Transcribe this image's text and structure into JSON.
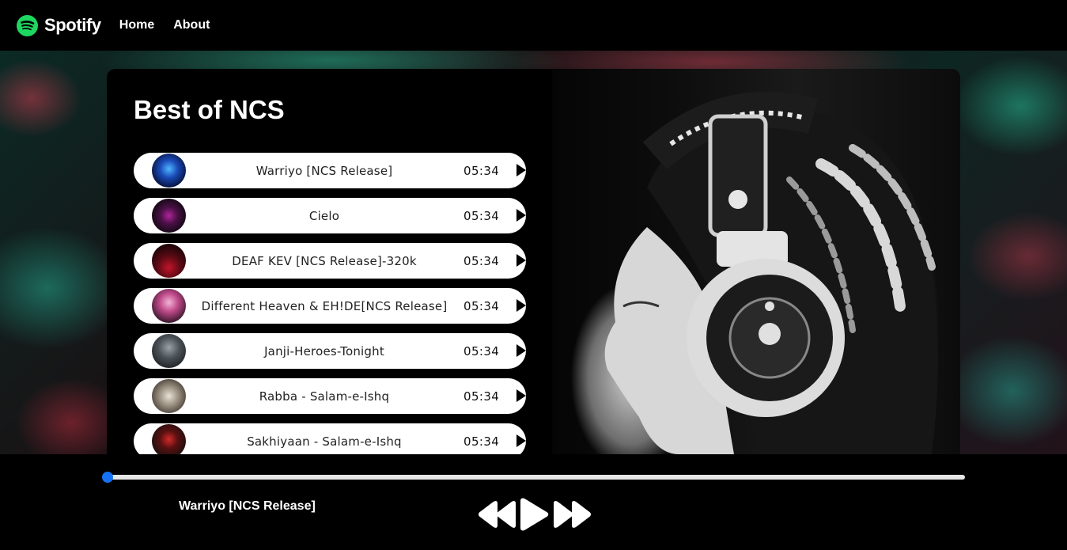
{
  "nav": {
    "brand": "Spotify",
    "links": [
      "Home",
      "About"
    ]
  },
  "playlist": {
    "title": "Best of NCS",
    "songs": [
      {
        "name": "Warriyo [NCS Release]",
        "duration": "05:34",
        "cover_icon": "album-cover-1"
      },
      {
        "name": "Cielo",
        "duration": "05:34",
        "cover_icon": "album-cover-2"
      },
      {
        "name": "DEAF KEV [NCS Release]-320k",
        "duration": "05:34",
        "cover_icon": "album-cover-3"
      },
      {
        "name": "Different Heaven & EH!DE[NCS Release]",
        "duration": "05:34",
        "cover_icon": "album-cover-4"
      },
      {
        "name": "Janji-Heroes-Tonight",
        "duration": "05:34",
        "cover_icon": "album-cover-5"
      },
      {
        "name": "Rabba - Salam-e-Ishq",
        "duration": "05:34",
        "cover_icon": "album-cover-6"
      },
      {
        "name": "Sakhiyaan - Salam-e-Ishq",
        "duration": "05:34",
        "cover_icon": "album-cover-7"
      }
    ]
  },
  "player": {
    "now_playing": "Warriyo [NCS Release]",
    "progress_fraction": 0.0,
    "accent_color": "#1572f4",
    "controls": [
      "previous-icon",
      "play-icon",
      "next-icon"
    ]
  },
  "colors": {
    "brand": "#1ed760",
    "background": "#000000",
    "song_item_bg": "#ffffff"
  }
}
